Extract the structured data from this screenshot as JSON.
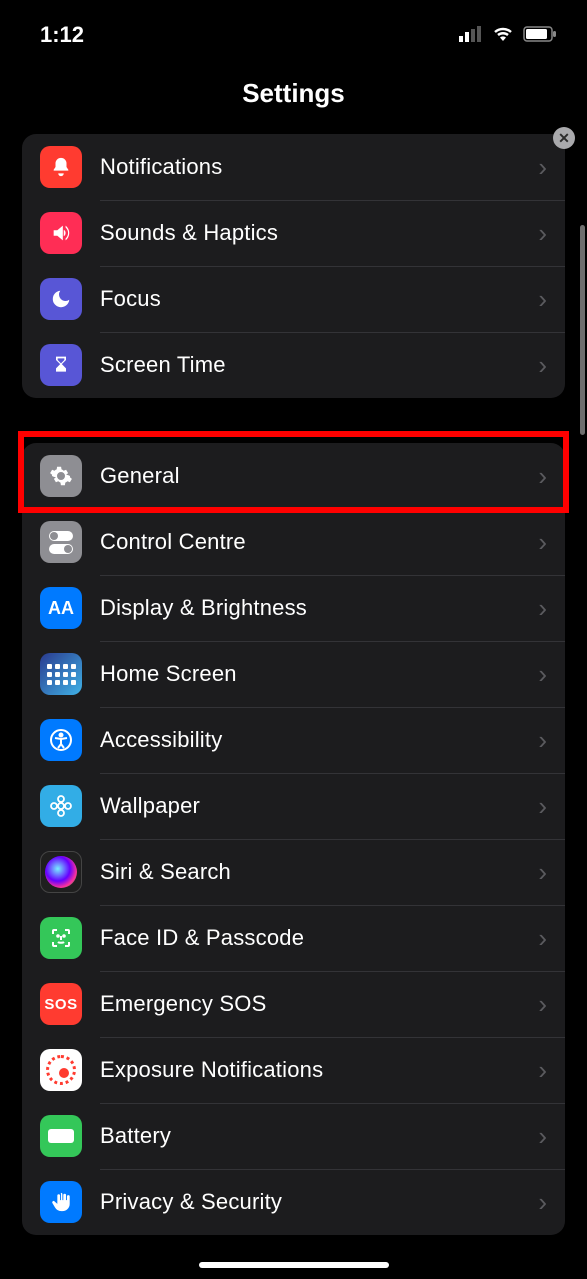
{
  "status": {
    "time": "1:12"
  },
  "header": {
    "title": "Settings"
  },
  "groups": [
    {
      "rows": [
        {
          "id": "notifications",
          "label": "Notifications"
        },
        {
          "id": "sounds",
          "label": "Sounds & Haptics"
        },
        {
          "id": "focus",
          "label": "Focus"
        },
        {
          "id": "screentime",
          "label": "Screen Time"
        }
      ]
    },
    {
      "rows": [
        {
          "id": "general",
          "label": "General"
        },
        {
          "id": "control",
          "label": "Control Centre"
        },
        {
          "id": "display",
          "label": "Display & Brightness"
        },
        {
          "id": "home",
          "label": "Home Screen"
        },
        {
          "id": "accessibility",
          "label": "Accessibility"
        },
        {
          "id": "wallpaper",
          "label": "Wallpaper"
        },
        {
          "id": "siri",
          "label": "Siri & Search"
        },
        {
          "id": "faceid",
          "label": "Face ID & Passcode"
        },
        {
          "id": "sos",
          "label": "Emergency SOS"
        },
        {
          "id": "exposure",
          "label": "Exposure Notifications"
        },
        {
          "id": "battery",
          "label": "Battery"
        },
        {
          "id": "privacy",
          "label": "Privacy & Security"
        }
      ]
    }
  ],
  "highlight_row": "general"
}
